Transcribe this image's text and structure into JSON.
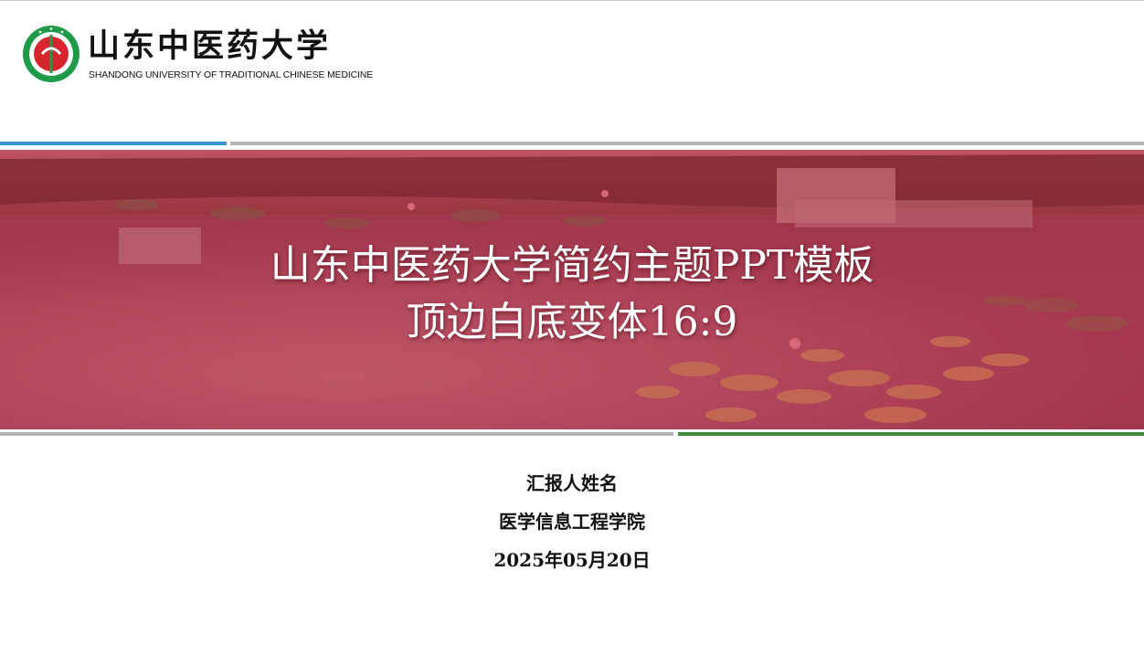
{
  "logo": {
    "name_cn": "山东中医药大学",
    "name_en": "SHANDONG UNIVERSITY OF TRADITIONAL CHINESE MEDICINE"
  },
  "slide": {
    "title_line1": "山东中医药大学简约主题PPT模板",
    "title_line2": "顶边白底变体16:9",
    "presenter": "汇报人姓名",
    "department": "医学信息工程学院",
    "date": "2025年05月20日"
  },
  "colors": {
    "accent_blue": "#3b95d1",
    "accent_green": "#3e8c3e",
    "divider_gray": "#b5b5b5",
    "banner_tint": "#aa283c",
    "logo_red": "#d6252e",
    "logo_green": "#1f9a48"
  },
  "icons": {
    "logo_seal": "university-seal-icon"
  }
}
